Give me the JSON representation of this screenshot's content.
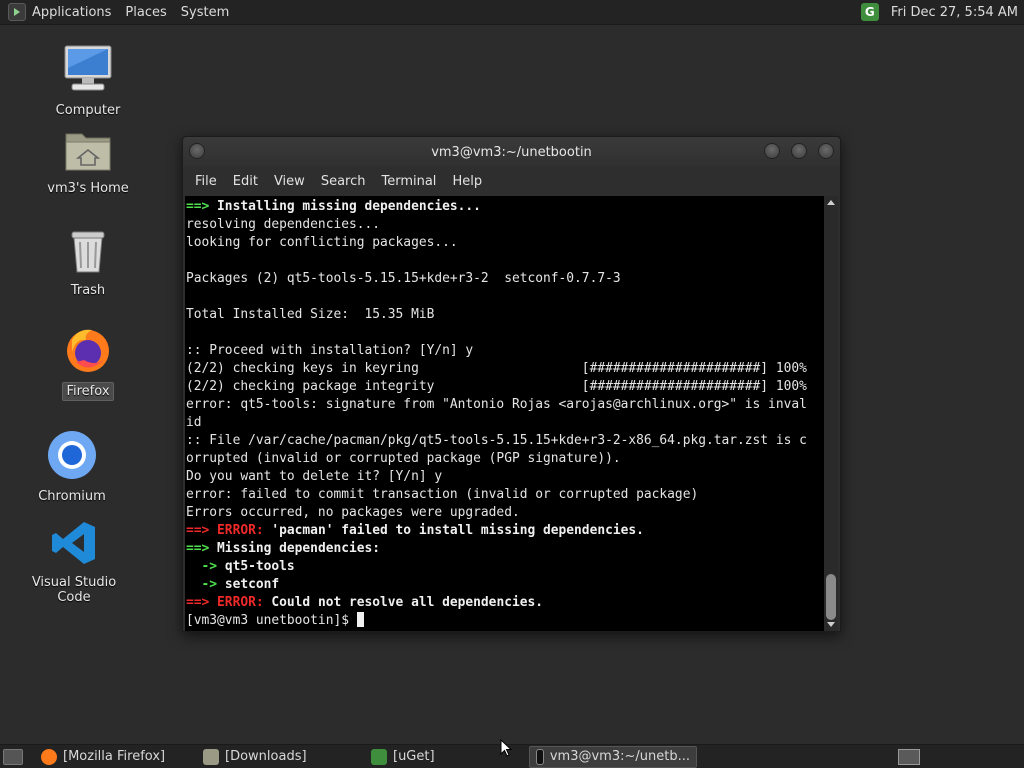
{
  "top_panel": {
    "menus": [
      "Applications",
      "Places",
      "System"
    ],
    "clock": "Fri Dec 27,  5:54 AM",
    "tray_icon_letter": "G"
  },
  "desktop_icons": [
    {
      "label": "Computer",
      "icon": "computer-icon"
    },
    {
      "label": "vm3's Home",
      "icon": "home-folder-icon"
    },
    {
      "label": "Trash",
      "icon": "trash-icon"
    },
    {
      "label": "Firefox",
      "icon": "firefox-icon",
      "selected": true
    },
    {
      "label": "Chromium",
      "icon": "chromium-icon"
    },
    {
      "label": "Visual Studio Code",
      "icon": "vscode-icon"
    }
  ],
  "terminal": {
    "title": "vm3@vm3:~/unetbootin",
    "menu": [
      "File",
      "Edit",
      "View",
      "Search",
      "Terminal",
      "Help"
    ],
    "lines": [
      [
        {
          "t": "==> ",
          "c": "g"
        },
        {
          "t": "Installing missing dependencies...",
          "c": "b"
        }
      ],
      [
        {
          "t": "resolving dependencies..."
        }
      ],
      [
        {
          "t": "looking for conflicting packages..."
        }
      ],
      [
        {
          "t": ""
        }
      ],
      [
        {
          "t": "Packages (2) qt5-tools-5.15.15+kde+r3-2  setconf-0.7.7-3"
        }
      ],
      [
        {
          "t": ""
        }
      ],
      [
        {
          "t": "Total Installed Size:  15.35 MiB"
        }
      ],
      [
        {
          "t": ""
        }
      ],
      [
        {
          "t": ":: Proceed with installation? [Y/n] y"
        }
      ],
      [
        {
          "t": "(2/2) checking keys in keyring                     [######################] 100%"
        }
      ],
      [
        {
          "t": "(2/2) checking package integrity                   [######################] 100%"
        }
      ],
      [
        {
          "t": "error: qt5-tools: signature from \"Antonio Rojas <arojas@archlinux.org>\" is inval"
        }
      ],
      [
        {
          "t": "id"
        }
      ],
      [
        {
          "t": ":: File /var/cache/pacman/pkg/qt5-tools-5.15.15+kde+r3-2-x86_64.pkg.tar.zst is c"
        }
      ],
      [
        {
          "t": "orrupted (invalid or corrupted package (PGP signature))."
        }
      ],
      [
        {
          "t": "Do you want to delete it? [Y/n] y"
        }
      ],
      [
        {
          "t": "error: failed to commit transaction (invalid or corrupted package)"
        }
      ],
      [
        {
          "t": "Errors occurred, no packages were upgraded."
        }
      ],
      [
        {
          "t": "==> ",
          "c": "r"
        },
        {
          "t": "ERROR: ",
          "c": "r"
        },
        {
          "t": "'pacman' failed to install missing dependencies.",
          "c": "b"
        }
      ],
      [
        {
          "t": "==> ",
          "c": "g"
        },
        {
          "t": "Missing dependencies:",
          "c": "b"
        }
      ],
      [
        {
          "t": "  -> ",
          "c": "g"
        },
        {
          "t": "qt5-tools",
          "c": "b"
        }
      ],
      [
        {
          "t": "  -> ",
          "c": "g"
        },
        {
          "t": "setconf",
          "c": "b"
        }
      ],
      [
        {
          "t": "==> ",
          "c": "r"
        },
        {
          "t": "ERROR: ",
          "c": "r"
        },
        {
          "t": "Could not resolve all dependencies.",
          "c": "b"
        }
      ],
      [
        {
          "t": "[vm3@vm3 unetbootin]$ "
        }
      ]
    ]
  },
  "taskbar": {
    "tasks": [
      {
        "label": "[Mozilla Firefox]",
        "icon": "firefox-icon",
        "active": false
      },
      {
        "label": "[Downloads]",
        "icon": "folder-icon",
        "active": false
      },
      {
        "label": "[uGet]",
        "icon": "uget-icon",
        "active": false
      },
      {
        "label": "vm3@vm3:~/unetb...",
        "icon": "terminal-icon",
        "active": true
      }
    ]
  },
  "colors": {
    "prompt_green": "#4ee24e",
    "error_red": "#ef2929",
    "terminal_bg": "#000000",
    "desktop_bg": "#2c2c2c"
  }
}
